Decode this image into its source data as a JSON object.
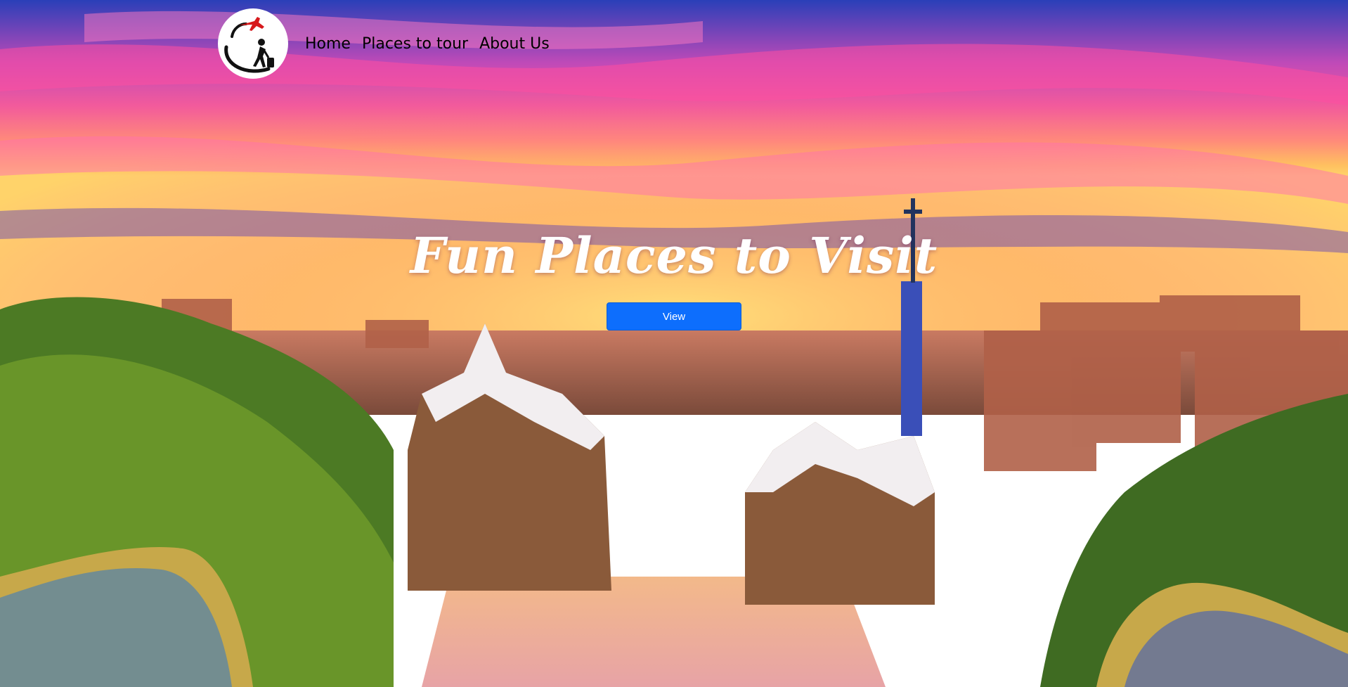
{
  "nav": {
    "logo_icon": "airplane-traveler-logo-icon",
    "links": [
      {
        "label": "Home"
      },
      {
        "label": "Places to tour"
      },
      {
        "label": "About Us"
      }
    ]
  },
  "hero": {
    "title": "Fun Places to Visit",
    "button_label": "View",
    "background_image": "park-guell-barcelona-sunset",
    "colors": {
      "button": "#0d6efd",
      "title": "#ffffff",
      "nav_text": "#000000"
    }
  }
}
